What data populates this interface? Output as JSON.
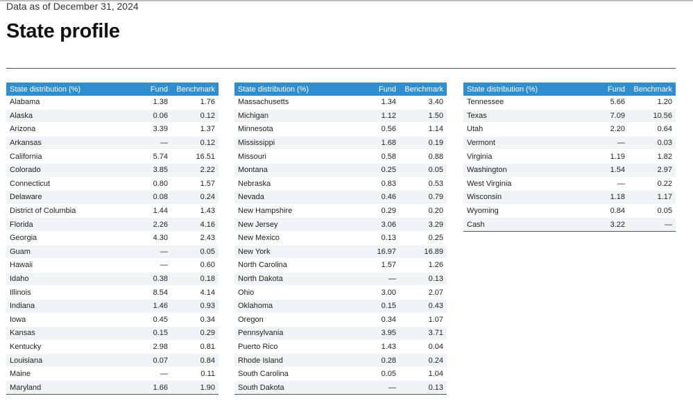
{
  "header": {
    "as_of": "Data as of December 31, 2024",
    "title": "State profile"
  },
  "columns": {
    "state": "State distribution (%)",
    "fund": "Fund",
    "benchmark": "Benchmark"
  },
  "tables": [
    [
      [
        "Alabama",
        "1.38",
        "1.76"
      ],
      [
        "Alaska",
        "0.06",
        "0.12"
      ],
      [
        "Arizona",
        "3.39",
        "1.37"
      ],
      [
        "Arkansas",
        "—",
        "0.12"
      ],
      [
        "California",
        "5.74",
        "16.51"
      ],
      [
        "Colorado",
        "3.85",
        "2.22"
      ],
      [
        "Connecticut",
        "0.80",
        "1.57"
      ],
      [
        "Delaware",
        "0.08",
        "0.24"
      ],
      [
        "District of Columbia",
        "1.44",
        "1.43"
      ],
      [
        "Florida",
        "2.26",
        "4.16"
      ],
      [
        "Georgia",
        "4.30",
        "2.43"
      ],
      [
        "Guam",
        "—",
        "0.05"
      ],
      [
        "Hawaii",
        "—",
        "0.60"
      ],
      [
        "Idaho",
        "0.38",
        "0.18"
      ],
      [
        "Illinois",
        "8.54",
        "4.14"
      ],
      [
        "Indiana",
        "1.46",
        "0.93"
      ],
      [
        "Iowa",
        "0.45",
        "0.34"
      ],
      [
        "Kansas",
        "0.15",
        "0.29"
      ],
      [
        "Kentucky",
        "2.98",
        "0.81"
      ],
      [
        "Louisiana",
        "0.07",
        "0.84"
      ],
      [
        "Maine",
        "—",
        "0.11"
      ],
      [
        "Maryland",
        "1.66",
        "1.90"
      ]
    ],
    [
      [
        "Massachusetts",
        "1.34",
        "3.40"
      ],
      [
        "Michigan",
        "1.12",
        "1.50"
      ],
      [
        "Minnesota",
        "0.56",
        "1.14"
      ],
      [
        "Mississippi",
        "1.68",
        "0.19"
      ],
      [
        "Missouri",
        "0.58",
        "0.88"
      ],
      [
        "Montana",
        "0.25",
        "0.05"
      ],
      [
        "Nebraska",
        "0.83",
        "0.53"
      ],
      [
        "Nevada",
        "0.46",
        "0.79"
      ],
      [
        "New Hampshire",
        "0.29",
        "0.20"
      ],
      [
        "New Jersey",
        "3.06",
        "3.29"
      ],
      [
        "New Mexico",
        "0.13",
        "0.25"
      ],
      [
        "New York",
        "16.97",
        "16.89"
      ],
      [
        "North Carolina",
        "1.57",
        "1.26"
      ],
      [
        "North Dakota",
        "—",
        "0.13"
      ],
      [
        "Ohio",
        "3.00",
        "2.07"
      ],
      [
        "Oklahoma",
        "0.15",
        "0.43"
      ],
      [
        "Oregon",
        "0.34",
        "1.07"
      ],
      [
        "Pennsylvania",
        "3.95",
        "3.71"
      ],
      [
        "Puerto Rico",
        "1.43",
        "0.04"
      ],
      [
        "Rhode Island",
        "0.28",
        "0.24"
      ],
      [
        "South Carolina",
        "0.05",
        "1.04"
      ],
      [
        "South Dakota",
        "—",
        "0.13"
      ]
    ],
    [
      [
        "Tennessee",
        "5.66",
        "1.20"
      ],
      [
        "Texas",
        "7.09",
        "10.56"
      ],
      [
        "Utah",
        "2.20",
        "0.64"
      ],
      [
        "Vermont",
        "—",
        "0.03"
      ],
      [
        "Virginia",
        "1.19",
        "1.82"
      ],
      [
        "Washington",
        "1.54",
        "2.97"
      ],
      [
        "West Virginia",
        "—",
        "0.22"
      ],
      [
        "Wisconsin",
        "1.18",
        "1.17"
      ],
      [
        "Wyoming",
        "0.84",
        "0.05"
      ],
      [
        "Cash",
        "3.22",
        "—"
      ]
    ]
  ]
}
